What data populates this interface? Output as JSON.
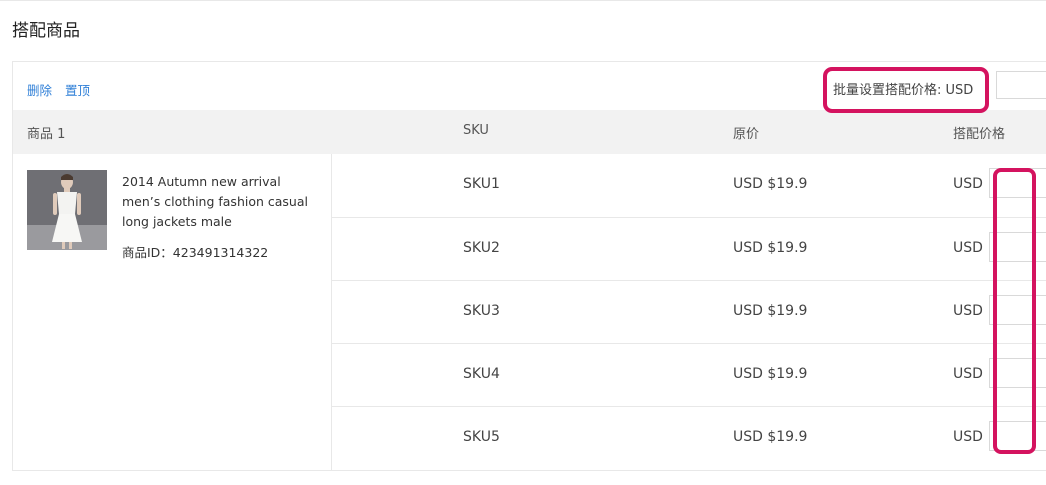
{
  "page": {
    "title": "搭配商品"
  },
  "toolbar": {
    "delete_label": "删除",
    "pin_label": "置顶",
    "bulk_price_label": "批量设置搭配价格: USD",
    "bulk_price_value": ""
  },
  "table": {
    "headers": {
      "product": "商品 1",
      "sku": "SKU",
      "original_price": "原价",
      "bundle_price": "搭配价格"
    },
    "product": {
      "title": "2014 Autumn new arrival men’s clothing fashion casual long jackets male",
      "id_label": "商品ID：423491314322"
    },
    "currency": "USD",
    "rows": [
      {
        "sku": "SKU1",
        "original_price": "USD $19.9",
        "bundle_price": ""
      },
      {
        "sku": "SKU2",
        "original_price": "USD $19.9",
        "bundle_price": ""
      },
      {
        "sku": "SKU3",
        "original_price": "USD $19.9",
        "bundle_price": ""
      },
      {
        "sku": "SKU4",
        "original_price": "USD $19.9",
        "bundle_price": ""
      },
      {
        "sku": "SKU5",
        "original_price": "USD $19.9",
        "bundle_price": ""
      }
    ]
  },
  "colors": {
    "highlight": "#d4135f",
    "link": "#2f7fd7",
    "header_bg": "#f2f2f2"
  }
}
